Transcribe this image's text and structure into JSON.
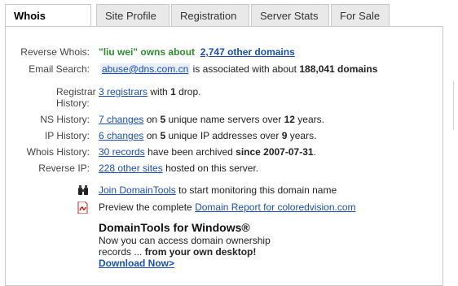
{
  "tabs": [
    {
      "label": "Whois Record",
      "active": true
    },
    {
      "label": "Site Profile",
      "active": false
    },
    {
      "label": "Registration",
      "active": false
    },
    {
      "label": "Server Stats",
      "active": false
    },
    {
      "label": "For Sale",
      "active": false
    }
  ],
  "reverse_whois": {
    "label": "Reverse Whois:",
    "owner": "\"liu wei\" owns about",
    "link": "2,747 other domains"
  },
  "email_search": {
    "label": "Email Search:",
    "email": "abuse@dns.com.cn",
    "text_pre": "is associated with about",
    "count": "188,041 domains"
  },
  "registrar_history": {
    "label_line1": "Registrar",
    "label_line2": "History:",
    "link": "3 registrars",
    "text1": "with",
    "count": "1",
    "text2": "drop."
  },
  "ns_history": {
    "label": "NS History:",
    "link": "7 changes",
    "text1": "on",
    "servers": "5",
    "text2": "unique name servers over",
    "years": "12",
    "text3": "years."
  },
  "ip_history": {
    "label": "IP History:",
    "link": "6 changes",
    "text1": "on",
    "addresses": "5",
    "text2": "unique IP addresses over",
    "years": "9",
    "text3": "years."
  },
  "whois_history": {
    "label": "Whois History:",
    "link": "30 records",
    "text1": "have been archived",
    "since": "since 2007-07-31",
    "text2": "."
  },
  "reverse_ip": {
    "label": "Reverse IP:",
    "link": "228 other sites",
    "text": "hosted on this server."
  },
  "monitor": {
    "icon": "binoculars-icon",
    "link": "Join DomainTools",
    "text": "to start monitoring this domain name"
  },
  "report": {
    "icon": "pdf-icon",
    "text": "Preview the complete",
    "link": "Domain Report for coloredvision.com"
  },
  "promo": {
    "title": "DomainTools for Windows®",
    "line1": "Now you can access domain ownership",
    "line2_pre": "records ...",
    "line2_bold": "from your own desktop!",
    "download": "Download Now>"
  }
}
